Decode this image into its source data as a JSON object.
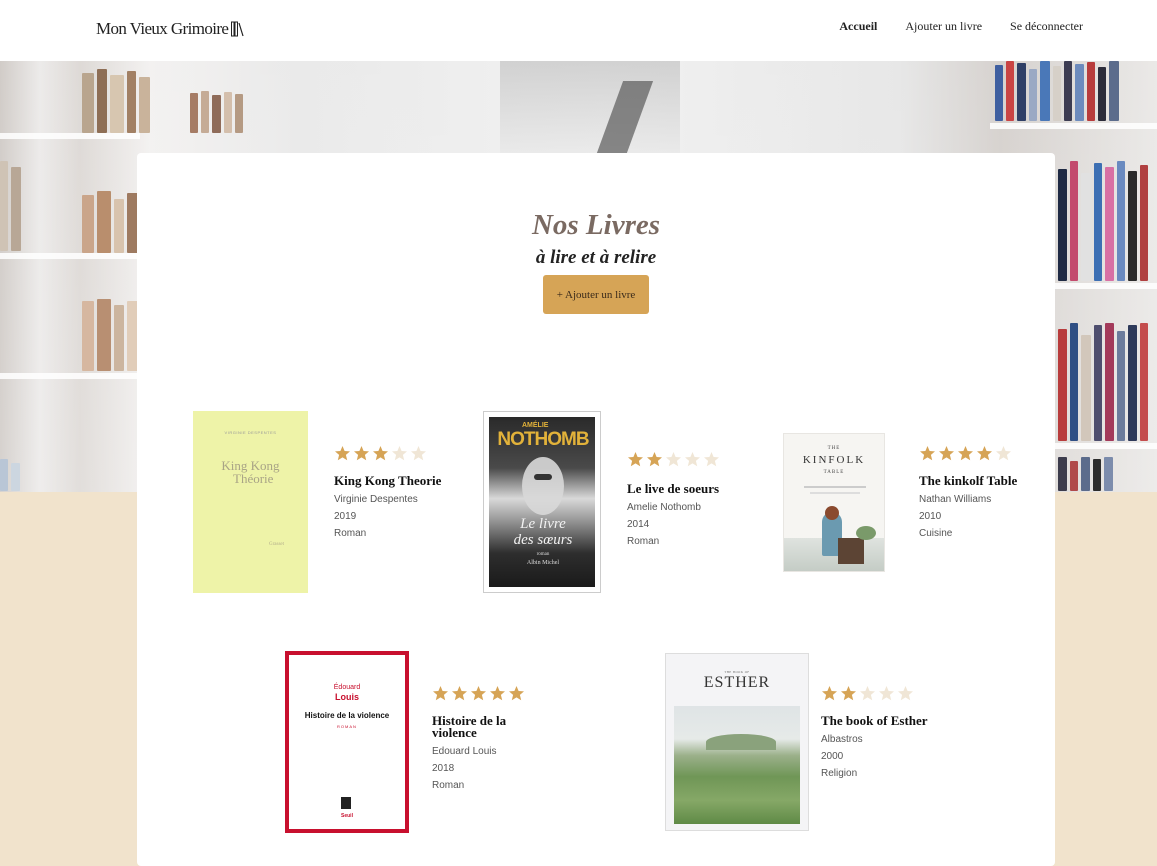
{
  "header": {
    "logo": "Mon Vieux Grimoire",
    "nav": [
      "Accueil",
      "Ajouter un livre",
      "Se déconnecter"
    ]
  },
  "main": {
    "title": "Nos Livres",
    "subtitle": "à lire et à relire",
    "add_button": "+ Ajouter un livre"
  },
  "colors": {
    "accent": "#d6a456",
    "star_filled": "#d6a456",
    "star_empty": "#f0e6d6",
    "page_bg": "#f1e3cc"
  },
  "books": [
    {
      "title": "King Kong Theorie",
      "author": "Virginie Despentes",
      "year": "2019",
      "genre": "Roman",
      "rating": 3,
      "cover": {
        "top_text": "VIRGINIE DESPENTES",
        "title_line1": "King Kong",
        "title_line2": "Théorie",
        "publisher": "Grasset"
      }
    },
    {
      "title": "Le live de soeurs",
      "author": "Amelie Nothomb",
      "year": "2014",
      "genre": "Roman",
      "rating": 2,
      "cover": {
        "top_text": "AMÉLIE",
        "name": "NOTHOMB",
        "title_line1": "Le livre",
        "title_line2": "des sœurs",
        "subtext": "roman",
        "publisher": "Albin Michel"
      }
    },
    {
      "title": "The kinkolf Table",
      "author": "Nathan Williams",
      "year": "2010",
      "genre": "Cuisine",
      "rating": 4,
      "cover": {
        "top_text": "THE",
        "title_line1": "KINFOLK",
        "title_line2": "TABLE"
      }
    },
    {
      "title": "Histoire de la violence",
      "author": "Edouard Louis",
      "year": "2018",
      "genre": "Roman",
      "rating": 5,
      "cover": {
        "top_text": "Édouard",
        "name": "Louis",
        "title_line1": "Histoire de la violence",
        "subtext": "ROMAN",
        "publisher": "Seuil"
      }
    },
    {
      "title": "The book of Esther",
      "author": "Albastros",
      "year": "2000",
      "genre": "Religion",
      "rating": 2,
      "cover": {
        "top_text": "THE BOOK OF",
        "title_line1": "ESTHER"
      }
    }
  ]
}
